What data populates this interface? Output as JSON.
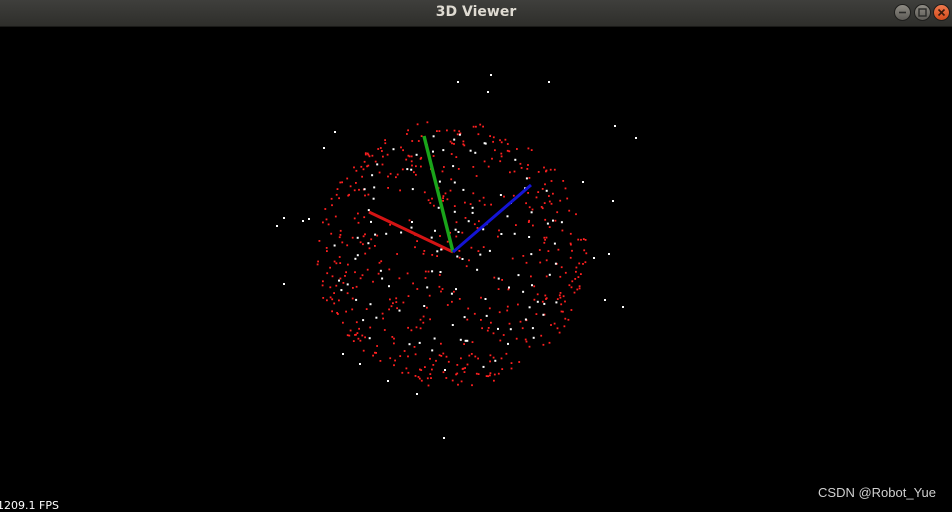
{
  "window": {
    "title": "3D Viewer",
    "controls": {
      "minimize_icon": "minimize-icon",
      "maximize_icon": "maximize-icon",
      "close_icon": "close-icon"
    }
  },
  "viewer": {
    "background": "#000000",
    "fps_text": "1209.1 FPS",
    "watermark": "CSDN @Robot_Yue",
    "axes": [
      {
        "name": "x-axis",
        "color": "#d41414"
      },
      {
        "name": "y-axis",
        "color": "#1aa51a"
      },
      {
        "name": "z-axis",
        "color": "#1414d4"
      }
    ],
    "point_colors": {
      "sphere_points": "#ff2020",
      "landmark_points": "#ffffff"
    }
  }
}
